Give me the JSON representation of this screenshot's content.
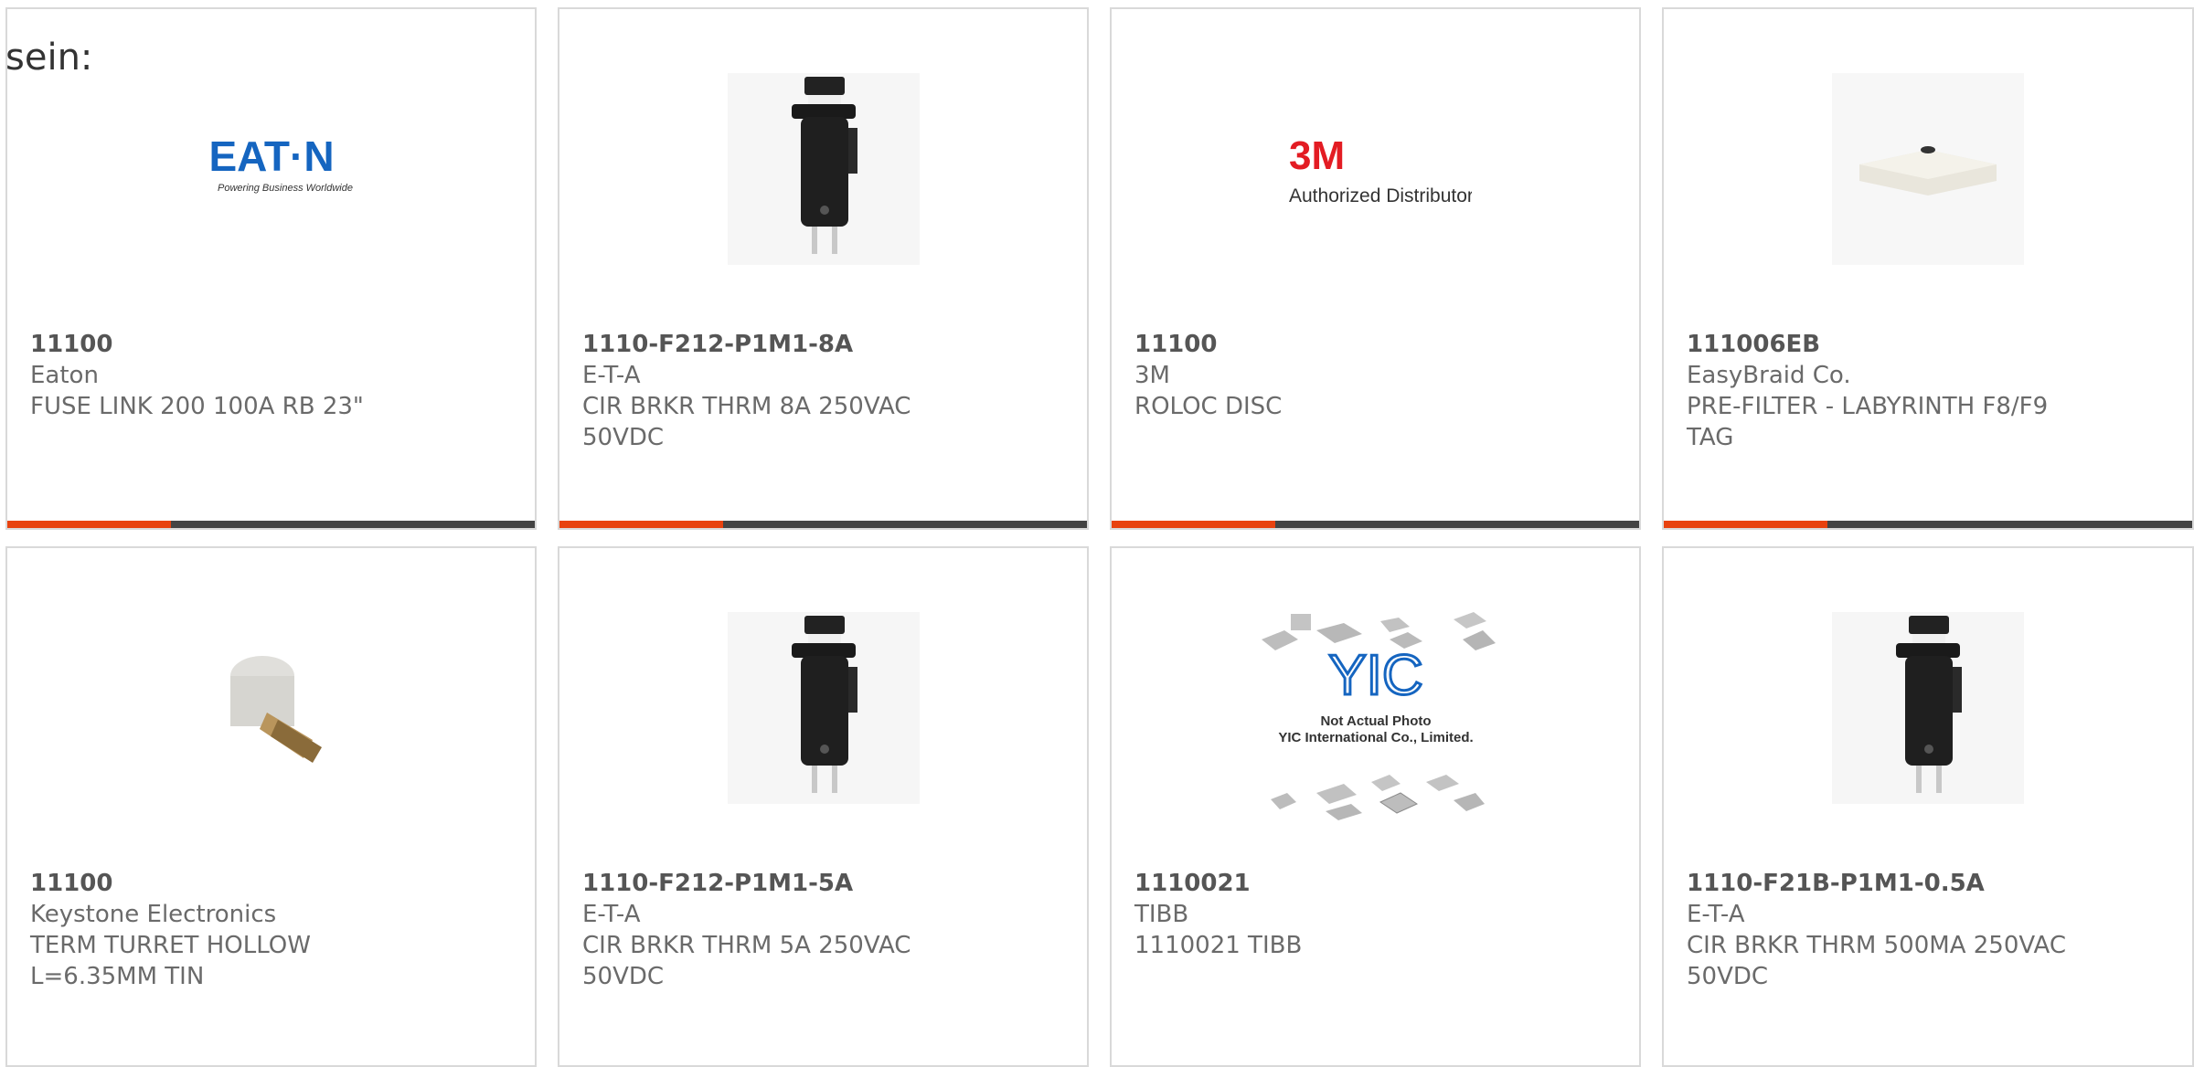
{
  "intro_text": "sein:",
  "colors": {
    "accent": "#e8420f",
    "bar": "#444444",
    "border": "#d9d9d9"
  },
  "cards": [
    {
      "part": "11100",
      "maker": "Eaton",
      "desc1": "FUSE LINK 200 100A RB 23\"",
      "desc2": "",
      "image": "eaton-logo",
      "logo": {
        "name": "EAT·N",
        "tagline": "Powering Business Worldwide"
      },
      "accent_fraction": 0.31
    },
    {
      "part": "1110-F212-P1M1-8A",
      "maker": "E-T-A",
      "desc1": "CIR BRKR THRM 8A 250VAC",
      "desc2": "50VDC",
      "image": "circuit-breaker",
      "accent_fraction": 0.31
    },
    {
      "part": "11100",
      "maker": "3M",
      "desc1": "ROLOC DISC",
      "desc2": "",
      "image": "3m-logo",
      "logo": {
        "name": "3M",
        "tagline": "Authorized Distributor"
      },
      "accent_fraction": 0.31
    },
    {
      "part": "111006EB",
      "maker": "EasyBraid Co.",
      "desc1": "PRE-FILTER - LABYRINTH F8/F9",
      "desc2": "TAG",
      "image": "filter-pad",
      "accent_fraction": 0.31
    },
    {
      "part": "11100",
      "maker": "Keystone Electronics",
      "desc1": "TERM TURRET HOLLOW",
      "desc2": "L=6.35MM TIN",
      "image": "turret-terminal",
      "accent_fraction": 0
    },
    {
      "part": "1110-F212-P1M1-5A",
      "maker": "E-T-A",
      "desc1": "CIR BRKR THRM 5A 250VAC",
      "desc2": "50VDC",
      "image": "circuit-breaker",
      "accent_fraction": 0
    },
    {
      "part": "1110021",
      "maker": "TIBB",
      "desc1": "1110021 TIBB",
      "desc2": "",
      "image": "yic-placeholder",
      "logo": {
        "name": "YIC",
        "line1": "Not Actual Photo",
        "line2": "YIC International Co., Limited."
      },
      "accent_fraction": 0
    },
    {
      "part": "1110-F21B-P1M1-0.5A",
      "maker": "E-T-A",
      "desc1": "CIR BRKR THRM 500MA 250VAC",
      "desc2": "50VDC",
      "image": "circuit-breaker",
      "accent_fraction": 0
    }
  ]
}
